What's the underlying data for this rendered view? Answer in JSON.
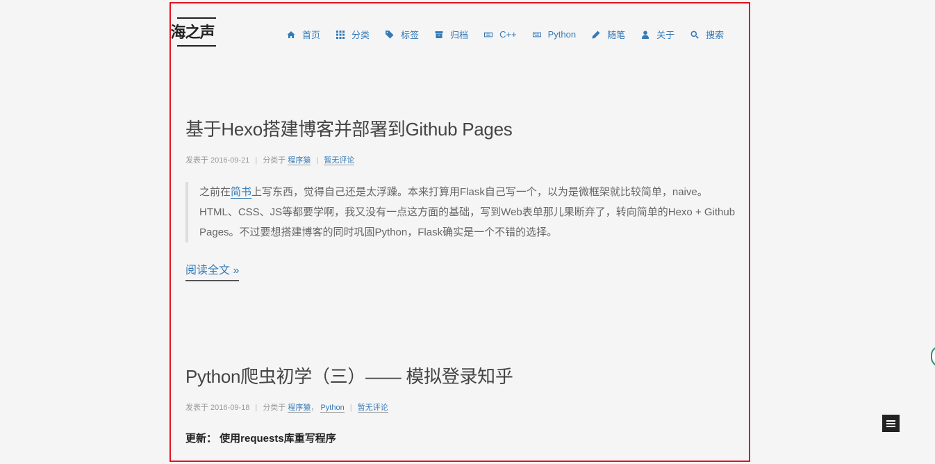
{
  "site": {
    "logo": "海之声"
  },
  "nav": [
    {
      "label": "首页",
      "icon": "home-icon"
    },
    {
      "label": "分类",
      "icon": "th-icon"
    },
    {
      "label": "标签",
      "icon": "tags-icon"
    },
    {
      "label": "归档",
      "icon": "archive-icon"
    },
    {
      "label": "C++",
      "icon": "keyboard-icon"
    },
    {
      "label": "Python",
      "icon": "keyboard-icon"
    },
    {
      "label": "随笔",
      "icon": "pencil-icon"
    },
    {
      "label": "关于",
      "icon": "user-icon"
    },
    {
      "label": "搜索",
      "icon": "search-icon"
    }
  ],
  "posts": [
    {
      "title": "基于Hexo搭建博客并部署到Github Pages",
      "meta_prefix": "发表于 2016-09-21",
      "sep": "|",
      "category_prefix": "分类于",
      "categories": [
        "程序猿"
      ],
      "comments": "暂无评论",
      "excerpt_before": "之前在",
      "excerpt_link": "简书",
      "excerpt_after": "上写东西，觉得自己还是太浮躁。本来打算用Flask自己写一个，以为是微框架就比较简单，naive。HTML、CSS、JS等都要学啊，我又没有一点这方面的基础，写到Web表单那儿果断弃了，转向简单的Hexo + Github Pages。不过要想搭建博客的同时巩固Python，Flask确实是一个不错的选择。",
      "read_more": "阅读全文 »"
    },
    {
      "title": "Python爬虫初学（三）—— 模拟登录知乎",
      "meta_prefix": "发表于 2016-09-18",
      "sep": "|",
      "category_prefix": "分类于",
      "categories": [
        "程序猿",
        "Python"
      ],
      "category_joiner": "，",
      "comments": "暂无评论",
      "update": "更新：  使用requests库重写程序"
    }
  ],
  "colors": {
    "accent": "#337ab7",
    "frame": "#e0141e",
    "background": "#f5f5f5"
  }
}
